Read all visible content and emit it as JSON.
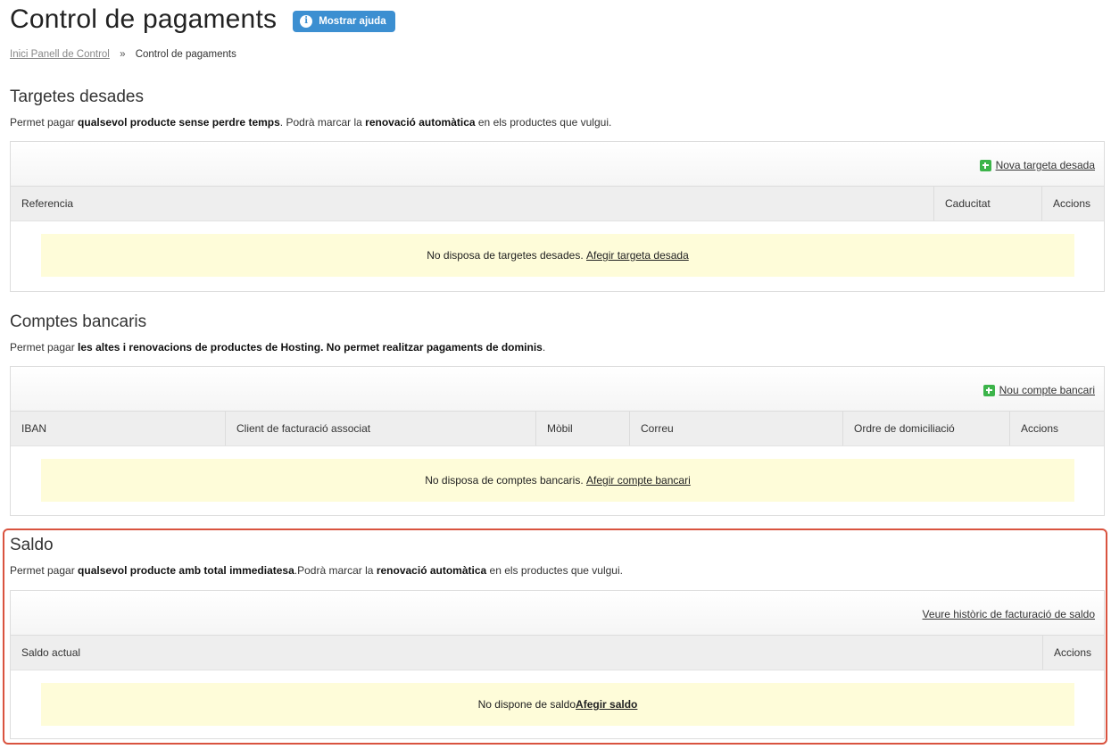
{
  "header": {
    "title": "Control de pagaments",
    "help_label": "Mostrar ajuda",
    "help_icon": "info-icon"
  },
  "breadcrumb": {
    "home": "Inici Panell de Control",
    "separator": "»",
    "current": "Control de pagaments"
  },
  "cards": {
    "title": "Targetes desades",
    "desc_1": "Permet pagar ",
    "desc_b1": "qualsevol producte sense perdre temps",
    "desc_2": ". Podrà marcar la ",
    "desc_b2": "renovació automàtica",
    "desc_3": " en els productes que vulgui.",
    "new_link": "Nova targeta desada",
    "columns": [
      "Referencia",
      "Caducitat",
      "Accions"
    ],
    "empty_text": "No disposa de targetes desades. ",
    "empty_link": "Afegir targeta desada"
  },
  "accounts": {
    "title": "Comptes bancaris",
    "desc_1": "Permet pagar ",
    "desc_b1": "les altes i renovacions de productes de Hosting. No permet realitzar pagaments de dominis",
    "desc_2": ".",
    "new_link": "Nou compte bancari",
    "columns": [
      "IBAN",
      "Client de facturació associat",
      "Mòbil",
      "Correu",
      "Ordre de domiciliació",
      "Accions"
    ],
    "empty_text": "No disposa de comptes bancaris. ",
    "empty_link": "Afegir compte bancari"
  },
  "balance": {
    "title": "Saldo",
    "desc_1": "Permet pagar ",
    "desc_b1": "qualsevol producte amb total immediatesa",
    "desc_2": ".Podrà marcar la ",
    "desc_b2": "renovació automàtica",
    "desc_3": " en els productes que vulgui.",
    "history_link": "Veure històric de facturació de saldo",
    "columns": [
      "Saldo actual",
      "Accions"
    ],
    "empty_text": "No dispone de saldo ",
    "empty_link": "Afegir saldo"
  },
  "colors": {
    "help_button": "#3c8fd1",
    "plus_icon": "#3cb44a",
    "notice_bg": "#fefcd9",
    "highlight_border": "#d9533f"
  }
}
